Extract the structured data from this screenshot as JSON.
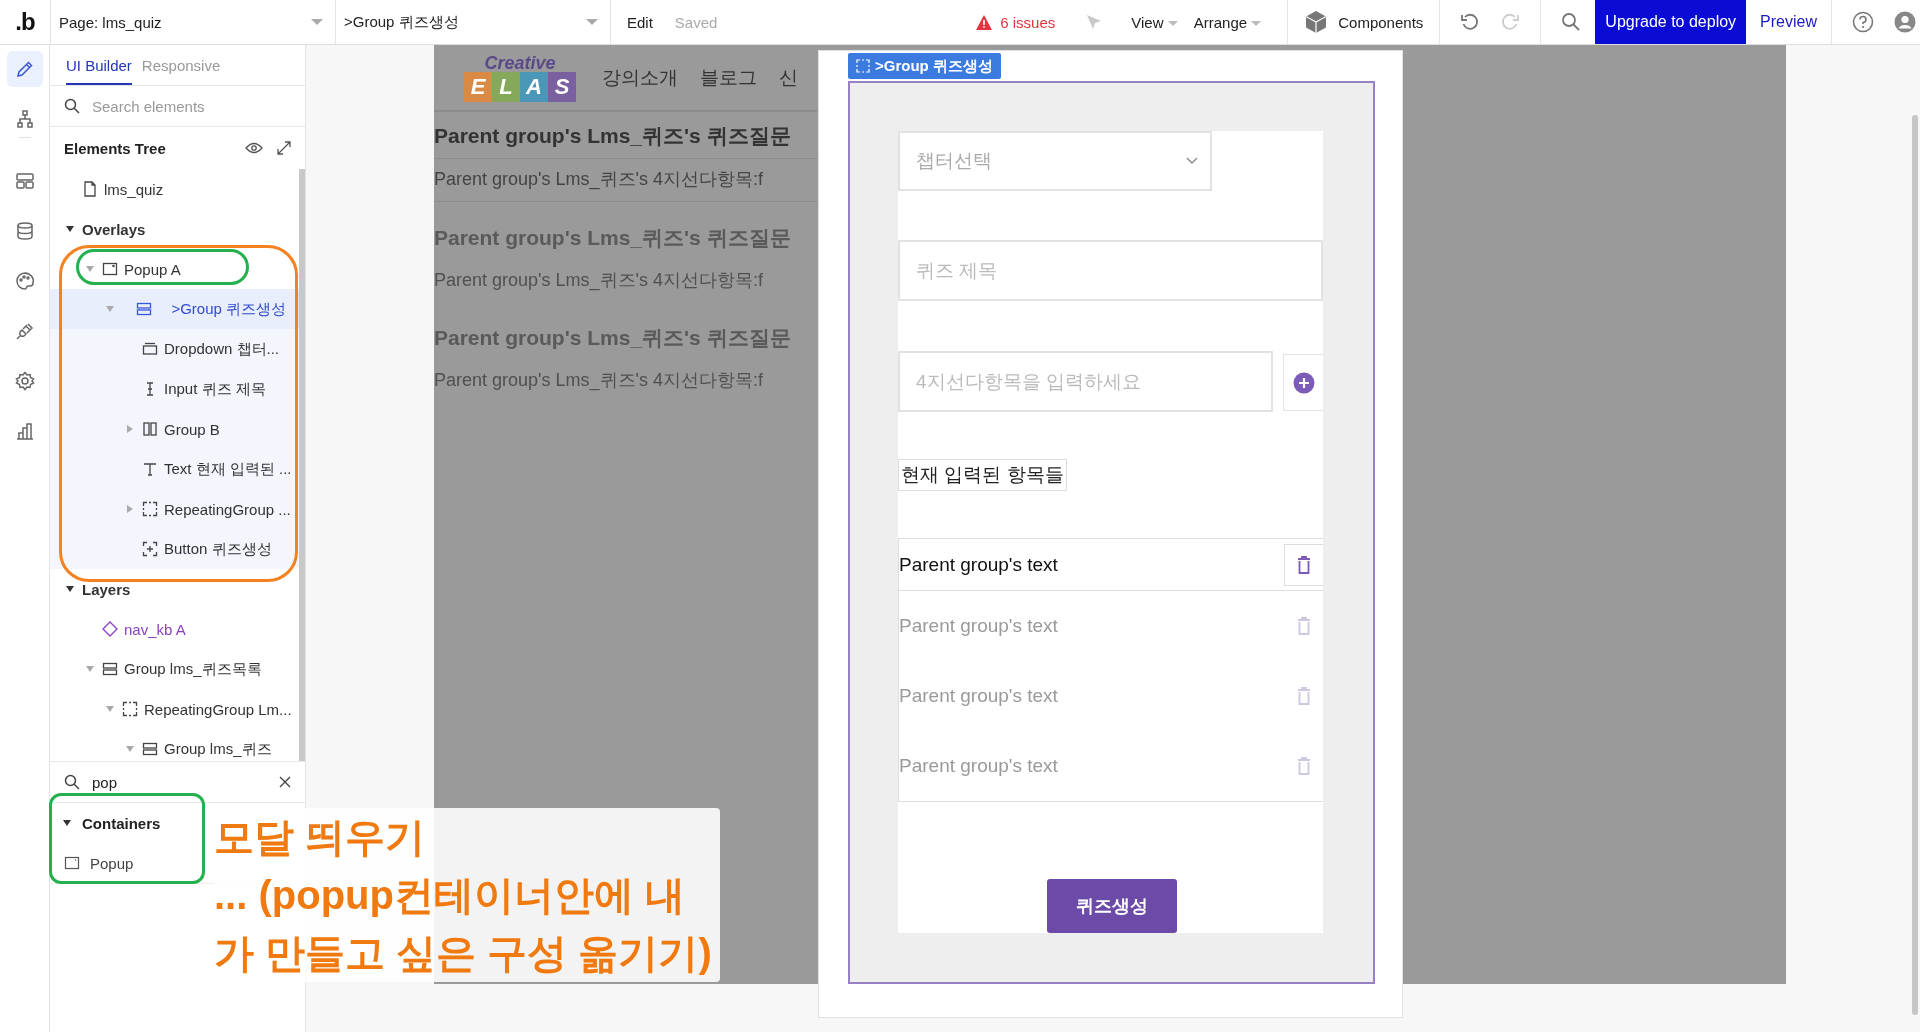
{
  "top_bar": {
    "logo": ".b",
    "page_selector": "Page: lms_quiz",
    "element_selector": ">Group 퀴즈생성",
    "edit": "Edit",
    "save_status": "Saved",
    "issues": "6 issues",
    "menus": [
      "View",
      "Arrange"
    ],
    "components": "Components",
    "upgrade": "Upgrade to deploy",
    "preview": "Preview"
  },
  "rail": [
    {
      "kind": "pencil",
      "selected": true
    },
    {
      "kind": "hierarchy",
      "selected": false
    },
    {
      "kind": "layout",
      "selected": false
    },
    {
      "kind": "database",
      "selected": false
    },
    {
      "kind": "palette",
      "selected": false
    },
    {
      "kind": "plug",
      "selected": false
    },
    {
      "kind": "gear",
      "selected": false
    },
    {
      "kind": "chart",
      "selected": false
    }
  ],
  "panel": {
    "tabs": [
      {
        "label": "UI Builder",
        "selected": true
      },
      {
        "label": "Responsive",
        "selected": false
      }
    ],
    "search": {
      "placeholder": "Search elements"
    },
    "tree_title": "Elements Tree",
    "tree": [
      {
        "kind": "page",
        "label": "lms_quiz",
        "selected": false
      },
      {
        "kind": "section",
        "label": "Overlays",
        "expanded": true,
        "selected": false,
        "children": [
          {
            "kind": "popup",
            "label": "Popup A",
            "expanded": true,
            "selected": false,
            "children": [
              {
                "kind": "group",
                "label": ">Group 퀴즈생성",
                "expanded": true,
                "selected": true,
                "children": [
                  {
                    "kind": "dropdown",
                    "label": "Dropdown 챕터...",
                    "selected": false
                  },
                  {
                    "kind": "input",
                    "label": "Input 퀴즈 제목",
                    "selected": false
                  },
                  {
                    "kind": "columns",
                    "label": "Group B",
                    "expanded": false,
                    "selected": false
                  },
                  {
                    "kind": "text",
                    "label": "Text 현재 입력된 ...",
                    "selected": false
                  },
                  {
                    "kind": "repeating",
                    "label": "RepeatingGroup ...",
                    "expanded": false,
                    "selected": false
                  },
                  {
                    "kind": "button",
                    "label": "Button 퀴즈생성",
                    "selected": false
                  }
                ]
              }
            ]
          }
        ]
      },
      {
        "kind": "section",
        "label": "Layers",
        "expanded": true,
        "selected": false,
        "children": [
          {
            "kind": "reusable",
            "label": "nav_kb A",
            "selected": false
          },
          {
            "kind": "group",
            "label": "Group lms_퀴즈목록",
            "expanded": true,
            "selected": false,
            "children": [
              {
                "kind": "repeating",
                "label": "RepeatingGroup Lm...",
                "expanded": true,
                "selected": false,
                "children": [
                  {
                    "kind": "group",
                    "label": "Group lms_퀴즈",
                    "expanded": true,
                    "selected": false
                  }
                ]
              }
            ]
          }
        ]
      }
    ],
    "palette_search": {
      "value": "pop"
    },
    "palette": [
      {
        "label": "Containers",
        "expanded": true,
        "items": [
          {
            "kind": "popup",
            "label": "Popup"
          }
        ]
      }
    ]
  },
  "page": {
    "logo_top": "Creative",
    "logo_letters": [
      {
        "letter": "E",
        "color": "#d98a45"
      },
      {
        "letter": "L",
        "color": "#86a85a"
      },
      {
        "letter": "A",
        "color": "#4b97b8"
      },
      {
        "letter": "S",
        "color": "#7a609e"
      }
    ],
    "nav": [
      "강의소개",
      "블로그",
      "신"
    ],
    "rows": [
      {
        "kind": "primary",
        "title": "Parent group's Lms_퀴즈's 퀴즈질문",
        "detail": "Parent group's Lms_퀴즈's 4지선다항목:f"
      },
      {
        "kind": "ghost",
        "title": "Parent group's Lms_퀴즈's 퀴즈질문",
        "detail": "Parent group's Lms_퀴즈's 4지선다항목:f"
      },
      {
        "kind": "ghost",
        "title": "Parent group's Lms_퀴즈's 퀴즈질문",
        "detail": "Parent group's Lms_퀴즈's 4지선다항목:f"
      }
    ]
  },
  "popup": {
    "group_label": ">Group 퀴즈생성",
    "dropdown": {
      "placeholder": "챕터선택"
    },
    "title_input": {
      "placeholder": "퀴즈 제목"
    },
    "option_input": {
      "placeholder": "4지선다항목을 입력하세요"
    },
    "current_label": "현재 입력된 항목들",
    "items": [
      {
        "kind": "primary",
        "text": "Parent group's text"
      },
      {
        "kind": "ghost",
        "text": "Parent group's text"
      },
      {
        "kind": "ghost",
        "text": "Parent group's text"
      },
      {
        "kind": "ghost",
        "text": "Parent group's text"
      }
    ],
    "button": "퀴즈생성"
  },
  "annotations": [
    {
      "kind": "outline",
      "color": "#f58220"
    },
    {
      "kind": "outline",
      "color": "#24b04c"
    },
    {
      "kind": "outline",
      "color": "#24b04c"
    }
  ],
  "note": {
    "text": "모달 띄우기\n**... (popup**컨테이너안에 내\n가 만들고 싶은 구성 옮기기)",
    "color": "#f07a10"
  }
}
